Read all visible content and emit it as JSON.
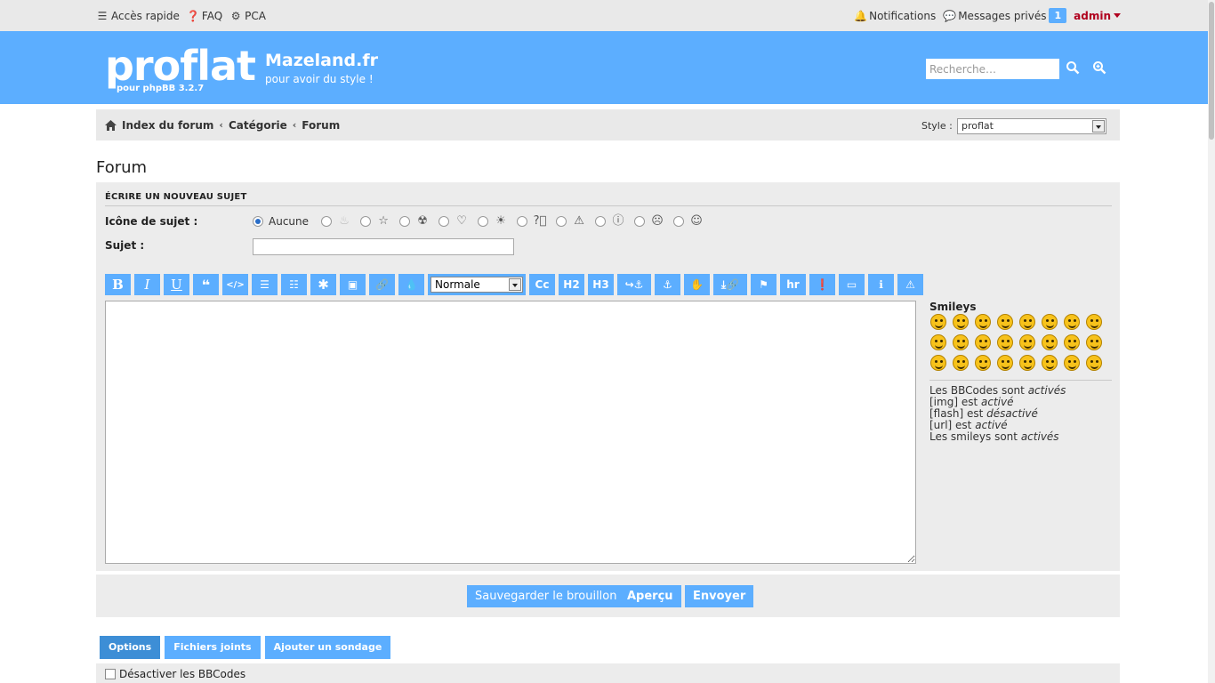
{
  "topbar": {
    "quick_access": "Accès rapide",
    "faq": "FAQ",
    "pca": "PCA",
    "notifications": "Notifications",
    "private_messages": "Messages privés",
    "pm_count": "1",
    "user": "admin"
  },
  "header": {
    "logo": "proflat",
    "logo_sub": "pour phpBB 3.2.7",
    "site_title": "Mazeland.fr",
    "site_desc": "pour avoir du style !",
    "search_placeholder": "Recherche…"
  },
  "breadcrumbs": {
    "items": [
      "Index du forum",
      "Catégorie",
      "Forum"
    ],
    "style_label": "Style :",
    "style_value": "proflat"
  },
  "page_title": "Forum",
  "post_form": {
    "heading": "ÉCRIRE UN NOUVEAU SUJET",
    "topic_icon_label": "Icône de sujet :",
    "topic_icon_none": "Aucune",
    "subject_label": "Sujet :",
    "subject_value": "",
    "font_size_value": "Normale",
    "toolbar": {
      "bold": "B",
      "italic": "I",
      "underline": "U",
      "cc": "Cc",
      "h2": "H2",
      "h3": "H3",
      "hr": "hr"
    },
    "message_value": ""
  },
  "smileys": {
    "title": "Smileys",
    "count": 24
  },
  "bbinfo": {
    "bbcode_prefix": "Les BBCodes sont",
    "bbcode_state": "activés",
    "img_prefix": "[img] est",
    "img_state": "activé",
    "flash_prefix": "[flash] est",
    "flash_state": "désactivé",
    "url_prefix": "[url] est",
    "url_state": "activé",
    "smileys_prefix": "Les smileys sont",
    "smileys_state": "activés"
  },
  "actions": {
    "save_draft": "Sauvegarder le brouillon",
    "preview": "Aperçu",
    "submit": "Envoyer"
  },
  "tabs": [
    "Options",
    "Fichiers joints",
    "Ajouter un sondage"
  ],
  "options": {
    "disable_bbcode": "Désactiver les BBCodes"
  },
  "colors": {
    "accent": "#5caeff",
    "admin": "#b0001e"
  }
}
